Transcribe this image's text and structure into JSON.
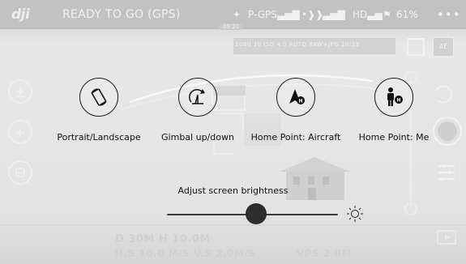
{
  "top_bar": {
    "logo": "dji",
    "status": "READY TO GO (GPS)",
    "gps_mode": "P-GPS",
    "hd_label": "HD",
    "battery": "61%",
    "more": "•••"
  },
  "timeline": {
    "time": "09:20"
  },
  "camera": {
    "readout": "1080  30  ISO  4.0   AUTO  RAW+JPG  20:33",
    "ae_label": "AE"
  },
  "telemetry": {
    "distance": "D 30M   H 10.0M",
    "speed": "H.S 10.0 M/S     V.S 2.0M/S",
    "vps": "VPS 2.0M"
  },
  "menu": {
    "actions": [
      {
        "label": "Portrait/Landscape",
        "icon": "rotate-screen-icon"
      },
      {
        "label": "Gimbal up/down",
        "icon": "gimbal-icon"
      },
      {
        "label": "Home Point: Aircraft",
        "icon": "home-point-aircraft-icon"
      },
      {
        "label": "Home Point: Me",
        "icon": "home-point-me-icon"
      }
    ],
    "brightness": {
      "label": "Adjust screen brightness",
      "value_percent": 52
    }
  },
  "colors": {
    "overlay_text": "#111111",
    "knob": "#2e2e2e",
    "faded_ui": "#f2f2f2"
  }
}
